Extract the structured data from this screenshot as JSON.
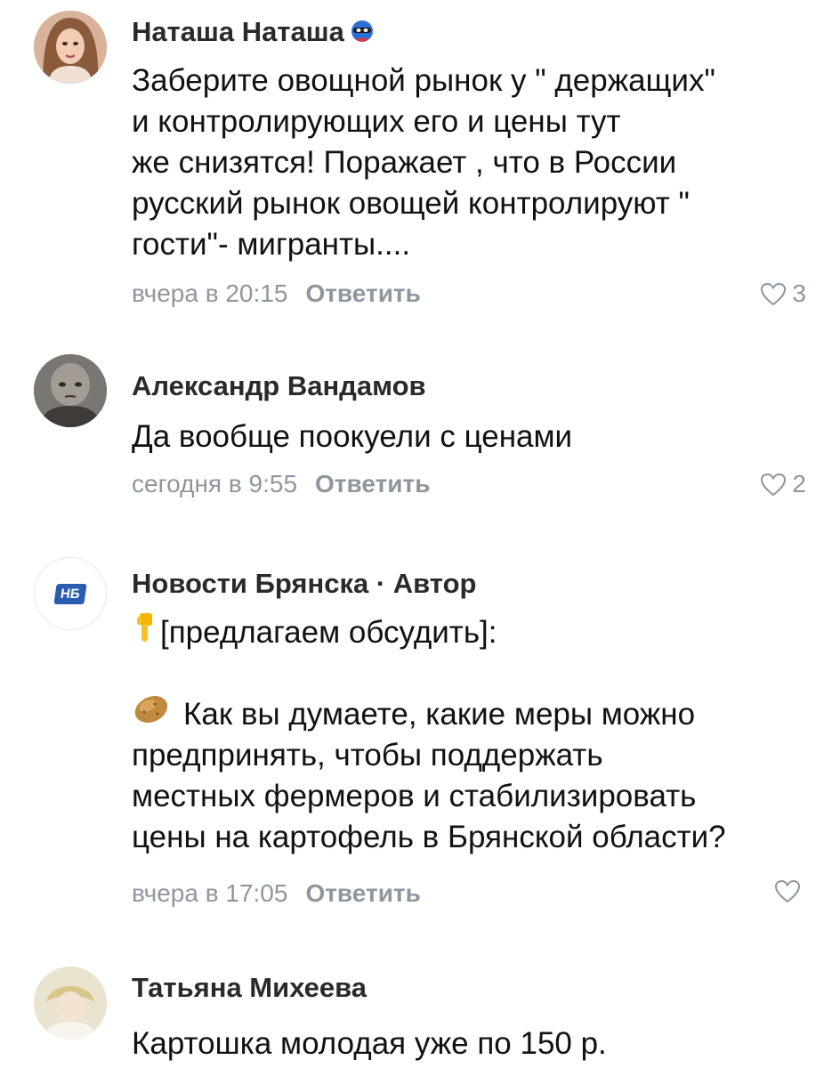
{
  "comments": [
    {
      "author": "Наташа Наташа",
      "text": "Заберите овощной рынок у \" держащих\"\nи контролирующих  его и цены тут\nже снизятся! Поражает , что в России\nрусский рынок овощей контролируют \"\nгости\"- мигранты....",
      "time": "вчера в 20:15",
      "reply": "Ответить",
      "likes": "3"
    },
    {
      "author": "Александр Вандамов",
      "text": "Да вообще поокуели с ценами",
      "time": "сегодня в 9:55",
      "reply": "Ответить",
      "likes": "2"
    },
    {
      "author": "Новости Брянска · Автор",
      "avatar_text": "НБ",
      "line1": "[предлагаем обсудить]:",
      "line2": "Как вы думаете, какие меры можно",
      "line3": "предпринять, чтобы поддержать\nместных фермеров и стабилизировать\nцены на картофель в Брянской области?",
      "time": "вчера в 17:05",
      "reply": "Ответить",
      "likes": ""
    },
    {
      "author": "Татьяна Михеева",
      "text": "Картошка молодая уже по 150 р."
    }
  ],
  "colors": {
    "meta_gray": "#8f969e",
    "brand_blue": "#2a5db0"
  }
}
